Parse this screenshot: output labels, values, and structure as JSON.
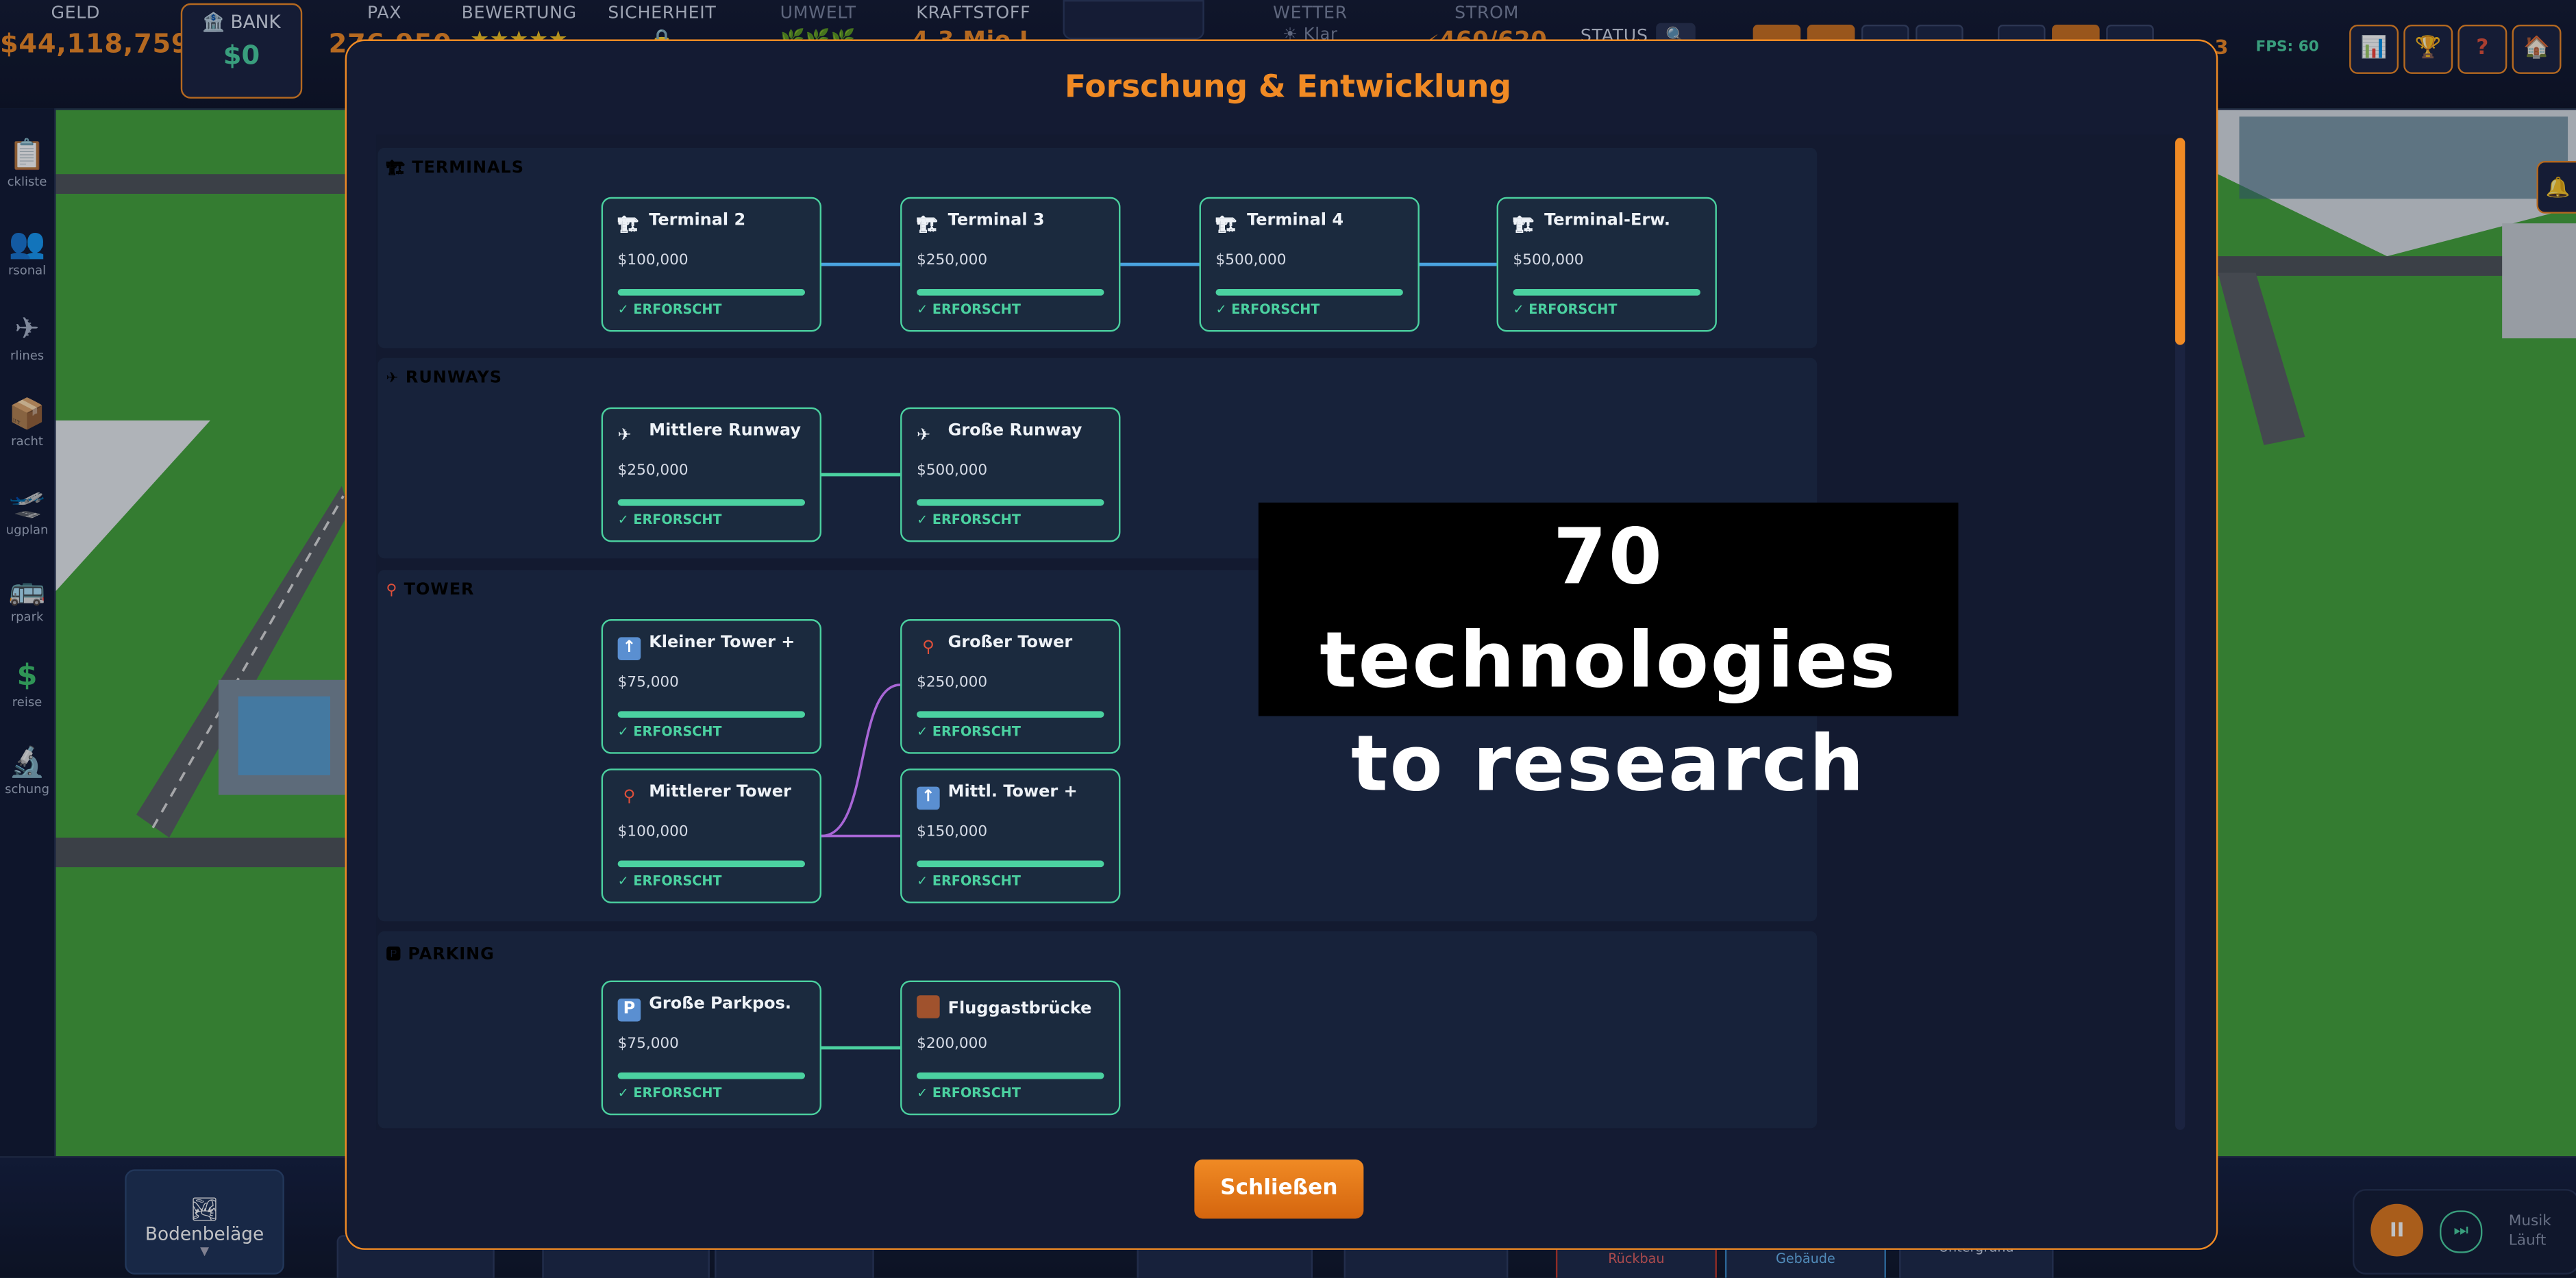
{
  "topbar": {
    "money_label": "GELD",
    "money_value": "$44,118,759",
    "bank_label": "BANK",
    "bank_value": "$0",
    "pax_label": "PAX",
    "pax_value": "276,950",
    "rating_label": "BEWERTUNG",
    "rating_value": "★★★★★",
    "security_label": "SICHERHEIT",
    "environment_label": "UMWELT",
    "fuel_label": "KRAFTSTOFF",
    "fuel_value": "4.3 Mio L",
    "weather_label": "WETTER",
    "weather_value": "Klar",
    "power_label": "STROM",
    "power_value": "460/620",
    "status_label": "STATUS",
    "fps_value": "FPS: 60",
    "partial_value": "3"
  },
  "sidebar": {
    "items": [
      {
        "label": "ckliste",
        "icon": "clipboard-icon"
      },
      {
        "label": "rsonal",
        "icon": "people-icon"
      },
      {
        "label": "rlines",
        "icon": "airplane-icon"
      },
      {
        "label": "racht",
        "icon": "package-icon"
      },
      {
        "label": "ugplan",
        "icon": "departure-icon"
      },
      {
        "label": "rpark",
        "icon": "bus-icon"
      },
      {
        "label": "reise",
        "icon": "dollar-icon"
      },
      {
        "label": "schung",
        "icon": "microscope-icon"
      }
    ]
  },
  "modal": {
    "title": "Forschung & Entwicklung",
    "close_label": "Schließen",
    "sections": [
      {
        "title": "TERMINALS",
        "color": "#4aa3df",
        "cards": [
          {
            "name": "Terminal 2",
            "cost": "$100,000",
            "status": "✓ ERFORSCHT",
            "progress": 1.0,
            "icon": "crane-icon"
          },
          {
            "name": "Terminal 3",
            "cost": "$250,000",
            "status": "✓ ERFORSCHT",
            "progress": 1.0,
            "icon": "crane-icon"
          },
          {
            "name": "Terminal 4",
            "cost": "$500,000",
            "status": "✓ ERFORSCHT",
            "progress": 1.0,
            "icon": "crane-icon"
          },
          {
            "name": "Terminal-Erw.",
            "cost": "$500,000",
            "status": "✓ ERFORSCHT",
            "progress": 1.0,
            "icon": "crane-icon"
          }
        ]
      },
      {
        "title": "RUNWAYS",
        "color": "#4bd1a0",
        "cards": [
          {
            "name": "Mittlere Runway",
            "cost": "$250,000",
            "status": "✓ ERFORSCHT",
            "progress": 1.0,
            "icon": "airplane-icon"
          },
          {
            "name": "Große Runway",
            "cost": "$500,000",
            "status": "✓ ERFORSCHT",
            "progress": 1.0,
            "icon": "airplane-icon"
          }
        ]
      },
      {
        "title": "TOWER",
        "color": "#a866d6",
        "cards": [
          {
            "name": "Kleiner Tower +",
            "cost": "$75,000",
            "status": "✓ ERFORSCHT",
            "progress": 1.0,
            "icon": "up-arrow-icon"
          },
          {
            "name": "Großer Tower",
            "cost": "$250,000",
            "status": "✓ ERFORSCHT",
            "progress": 1.0,
            "icon": "tower-icon"
          },
          {
            "name": "Mittlerer Tower",
            "cost": "$100,000",
            "status": "✓ ERFORSCHT",
            "progress": 1.0,
            "icon": "tower-icon"
          },
          {
            "name": "Mittl. Tower +",
            "cost": "$150,000",
            "status": "✓ ERFORSCHT",
            "progress": 1.0,
            "icon": "up-arrow-icon"
          }
        ]
      },
      {
        "title": "PARKING",
        "color": "#4bd1a0",
        "cards": [
          {
            "name": "Große Parkpos.",
            "cost": "$75,000",
            "status": "✓ ERFORSCHT",
            "progress": 1.0,
            "icon": "parking-icon"
          },
          {
            "name": "Fluggastbrücke",
            "cost": "$200,000",
            "status": "✓ ERFORSCHT",
            "progress": 1.0,
            "icon": "door-icon"
          }
        ]
      }
    ]
  },
  "caption": {
    "line1": "70 technologies",
    "line2": "to research"
  },
  "bottom": {
    "floor_label": "Bodenbeläge",
    "demolish_label": "Rückbau",
    "buildings_label": "Gebäude",
    "underground_label": "Untergrund",
    "music_label": "Musik",
    "music_status": "Läuft"
  }
}
